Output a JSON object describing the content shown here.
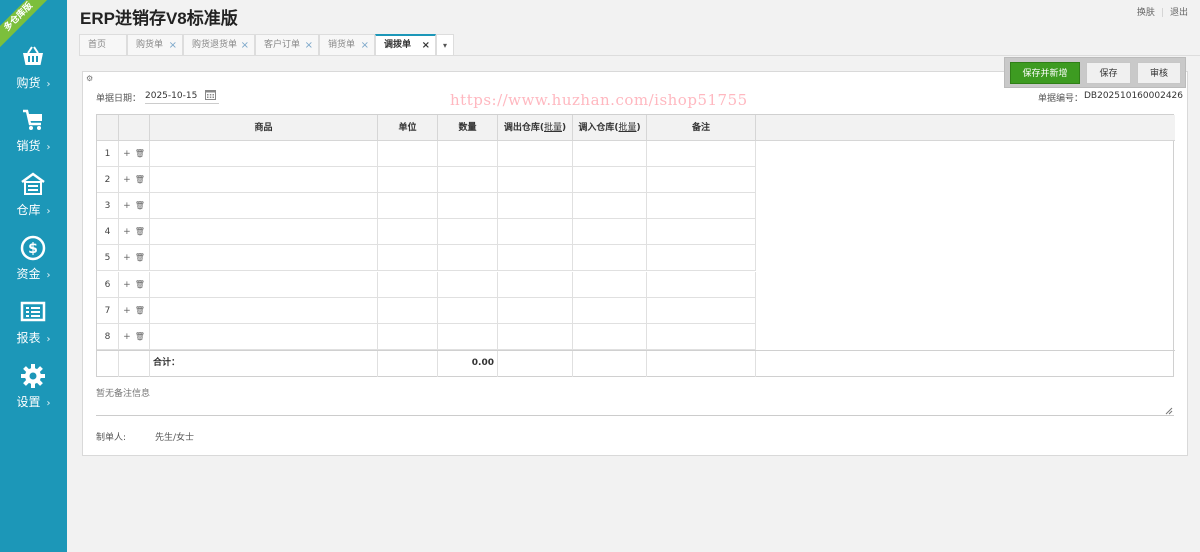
{
  "app": {
    "title": "ERP进销存V8标准版",
    "badge": "多仓库版",
    "top_links": [
      "换肤",
      "退出"
    ]
  },
  "sidebar": {
    "items": [
      {
        "label": "购货",
        "icon": "shopping-basket-icon"
      },
      {
        "label": "销货",
        "icon": "cart-icon"
      },
      {
        "label": "仓库",
        "icon": "warehouse-icon"
      },
      {
        "label": "资金",
        "icon": "dollar-icon"
      },
      {
        "label": "报表",
        "icon": "report-icon"
      },
      {
        "label": "设置",
        "icon": "gear-icon"
      }
    ],
    "arrow": "›"
  },
  "tabs": [
    {
      "label": "首页",
      "closable": false,
      "active": false
    },
    {
      "label": "购货单",
      "closable": true,
      "active": false
    },
    {
      "label": "购货退货单",
      "closable": true,
      "active": false
    },
    {
      "label": "客户订单",
      "closable": true,
      "active": false
    },
    {
      "label": "销货单",
      "closable": true,
      "active": false
    },
    {
      "label": "调拨单",
      "closable": true,
      "active": true
    }
  ],
  "tab_close": "×",
  "tab_more": "▾",
  "form": {
    "date_label": "单据日期：",
    "date_value": "2025-10-15",
    "number_label": "单据编号：",
    "number_value": "DB202510160002426",
    "watermark": "https://www.huzhan.com/ishop51755"
  },
  "actions": {
    "save_new": "保存并新增",
    "save": "保存",
    "audit": "审核"
  },
  "table": {
    "columns": [
      "商品",
      "单位",
      "数量",
      "调出仓库",
      "调入仓库",
      "备注"
    ],
    "batch_label": "批量",
    "rows": [
      1,
      2,
      3,
      4,
      5,
      6,
      7,
      8
    ],
    "add_glyph": "+",
    "delete_glyph": "🗑",
    "total_label": "合计：",
    "total_qty": "0.00"
  },
  "notes": {
    "placeholder": "暂无备注信息"
  },
  "footer": {
    "creator_label": "制单人:",
    "creator_value": "先生/女士"
  },
  "colors": {
    "sidebar": "#1c97b8",
    "primary_button": "#3d9b21",
    "ribbon": "#7cbf3c"
  }
}
